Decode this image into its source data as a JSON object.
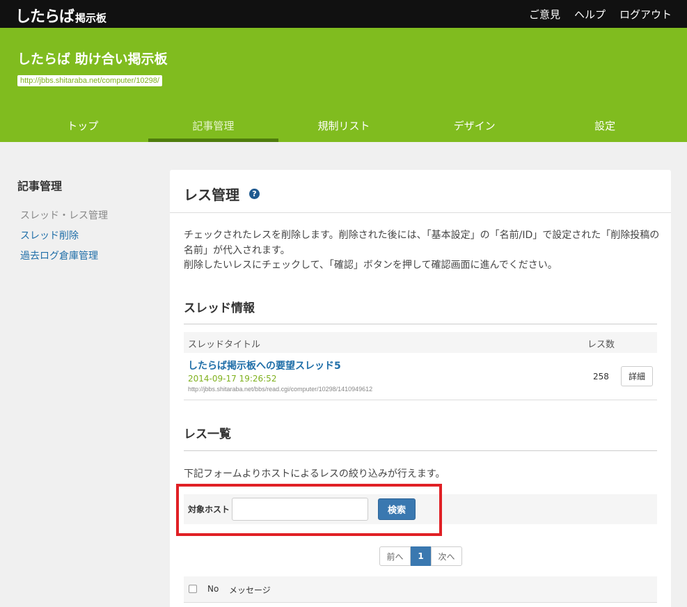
{
  "topbar": {
    "logo_main": "したらば",
    "logo_sub": "掲示板",
    "links": [
      "ご意見",
      "ヘルプ",
      "ログアウト"
    ]
  },
  "header": {
    "title": "したらば 助け合い掲示板",
    "url": "http://jbbs.shitaraba.net/computer/10298/",
    "tabs": [
      "トップ",
      "記事管理",
      "規制リスト",
      "デザイン",
      "設定"
    ],
    "active_tab": "記事管理"
  },
  "sidebar": {
    "title": "記事管理",
    "items": [
      "スレッド・レス管理",
      "スレッド削除",
      "過去ログ倉庫管理"
    ]
  },
  "panel": {
    "title": "レス管理",
    "help": "?",
    "desc_line1": "チェックされたレスを削除します。削除された後には、「基本設定」の「名前/ID」で設定された「削除投稿の名前」が代入されます。",
    "desc_line2": "削除したいレスにチェックして、「確認」ボタンを押して確認画面に進んでください。"
  },
  "thread_info": {
    "heading": "スレッド情報",
    "col_title": "スレッドタイトル",
    "col_count": "レス数",
    "thread_title": "したらば掲示板への要望スレッド5",
    "date": "2014-09-17 19:26:52",
    "url": "http://jbbs.shitaraba.net/bbs/read.cgi/computer/10298/1410949612",
    "count": "258",
    "detail_label": "詳細"
  },
  "res_list": {
    "heading": "レス一覧",
    "filter_desc": "下記フォームよりホストによるレスの絞り込みが行えます。",
    "host_label": "対象ホスト",
    "host_value": "",
    "search_label": "検索",
    "pager": {
      "prev": "前へ",
      "current": "1",
      "next": "次へ"
    },
    "col_no": "No",
    "col_msg": "メッセージ"
  },
  "colors": {
    "brand_green": "#80bc1f",
    "link_blue": "#1f6ea8",
    "button_blue": "#3a78b0",
    "highlight_red": "#e02025"
  }
}
